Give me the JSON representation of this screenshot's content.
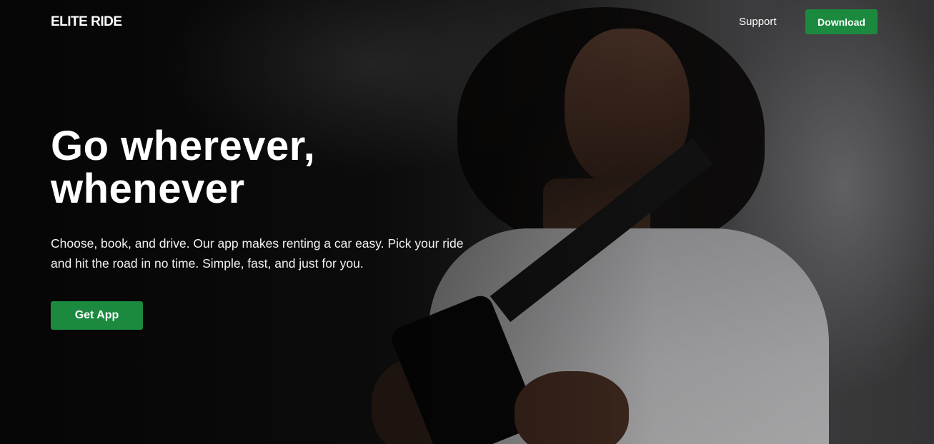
{
  "brand": {
    "logo_text": "ELITE RIDE",
    "accent_color": "#1b8a3f"
  },
  "nav": {
    "support_label": "Support",
    "download_label": "Download"
  },
  "hero": {
    "headline_line1": "Go wherever,",
    "headline_line2": "whenever",
    "description": "Choose, book, and drive. Our app makes renting a car easy. Pick your ride and hit the road in no time. Simple, fast, and just for you.",
    "cta_label": "Get App"
  }
}
